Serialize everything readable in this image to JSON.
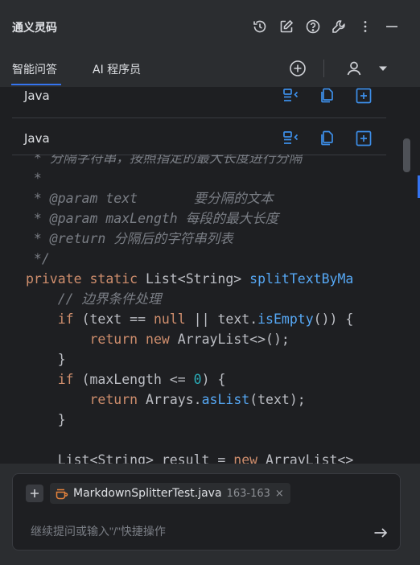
{
  "header": {
    "title": "通义灵码",
    "icons": [
      "history-icon",
      "edit-icon",
      "help-icon",
      "wrench-icon",
      "more-icon",
      "minimize-icon"
    ]
  },
  "tabs": [
    {
      "label": "智能问答",
      "active": true
    },
    {
      "label": "AI 程序员",
      "active": false
    }
  ],
  "blocks": [
    {
      "lang": "Java"
    },
    {
      "lang": "Java"
    }
  ],
  "code_lines": [
    [
      {
        "t": " * 分隔字符串，按照指定的最大长度进行分隔",
        "c": "cmt"
      }
    ],
    [
      {
        "t": " *",
        "c": "cmt"
      }
    ],
    [
      {
        "t": " * @param text       要分隔的文本",
        "c": "cmt"
      }
    ],
    [
      {
        "t": " * @param maxLength 每段的最大长度",
        "c": "cmt"
      }
    ],
    [
      {
        "t": " * @return 分隔后的字符串列表",
        "c": "cmt"
      }
    ],
    [
      {
        "t": " */",
        "c": "cmt"
      }
    ],
    [
      {
        "t": "private ",
        "c": "kw"
      },
      {
        "t": "static ",
        "c": "kw"
      },
      {
        "t": "List<String> ",
        "c": ""
      },
      {
        "t": "splitTextByMa",
        "c": "fn"
      }
    ],
    [
      {
        "t": "    ",
        "c": ""
      },
      {
        "t": "// 边界条件处理",
        "c": "cmt"
      }
    ],
    [
      {
        "t": "    ",
        "c": ""
      },
      {
        "t": "if ",
        "c": "kw"
      },
      {
        "t": "(text == ",
        "c": ""
      },
      {
        "t": "null",
        "c": "kw"
      },
      {
        "t": " || text.",
        "c": ""
      },
      {
        "t": "isEmpty",
        "c": "fn"
      },
      {
        "t": "()) {",
        "c": ""
      }
    ],
    [
      {
        "t": "        ",
        "c": ""
      },
      {
        "t": "return ",
        "c": "kw"
      },
      {
        "t": "new ",
        "c": "kw"
      },
      {
        "t": "ArrayList<>();",
        "c": ""
      }
    ],
    [
      {
        "t": "    }",
        "c": ""
      }
    ],
    [
      {
        "t": "    ",
        "c": ""
      },
      {
        "t": "if ",
        "c": "kw"
      },
      {
        "t": "(maxLength <= ",
        "c": ""
      },
      {
        "t": "0",
        "c": "num"
      },
      {
        "t": ") {",
        "c": ""
      }
    ],
    [
      {
        "t": "        ",
        "c": ""
      },
      {
        "t": "return ",
        "c": "kw"
      },
      {
        "t": "Arrays.",
        "c": ""
      },
      {
        "t": "asList",
        "c": "fn"
      },
      {
        "t": "(text);",
        "c": ""
      }
    ],
    [
      {
        "t": "    }",
        "c": ""
      }
    ],
    [
      {
        "t": "",
        "c": ""
      }
    ],
    [
      {
        "t": "    List<String> result = ",
        "c": ""
      },
      {
        "t": "new ",
        "c": "kw"
      },
      {
        "t": "ArrayList<>",
        "c": ""
      }
    ]
  ],
  "context_chip": {
    "name": "MarkdownSplitterTest.java",
    "range": "163-163",
    "close": "×"
  },
  "input": {
    "placeholder": "继续提问或输入\"/\"快捷操作"
  },
  "colors": {
    "accent": "#3574f0",
    "action_icon": "#3d8ee8"
  }
}
